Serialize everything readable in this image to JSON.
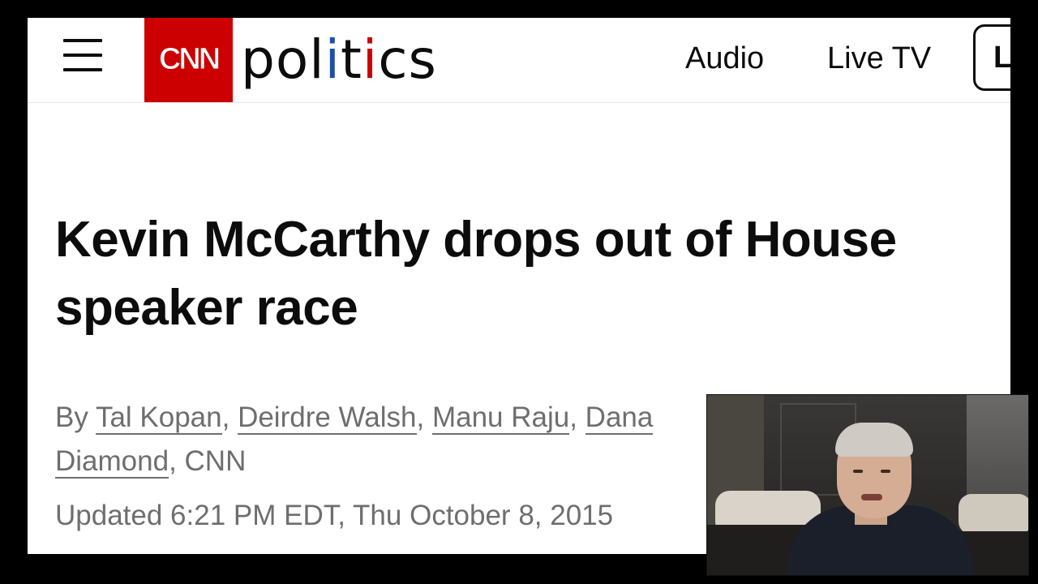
{
  "header": {
    "logo_text": "CNN",
    "section_prefix": "pol",
    "section_i1": "i",
    "section_mid": "t",
    "section_i2": "i",
    "section_suffix": "cs",
    "nav": {
      "audio": "Audio",
      "live_tv": "Live TV",
      "login_partial": "L"
    }
  },
  "article": {
    "headline": "Kevin McCarthy drops out of House speaker race",
    "byline_prefix": "By ",
    "authors": [
      "Tal Kopan",
      "Deirdre Walsh",
      "Manu Raju",
      "Dana",
      "Diamond"
    ],
    "byline_separator": ", ",
    "byline_suffix": ", CNN",
    "timestamp": "Updated 6:21 PM EDT, Thu October 8, 2015"
  },
  "colors": {
    "cnn_red": "#cc0000",
    "politics_blue": "#1e4fa8",
    "text_primary": "#0c0c0c",
    "text_secondary": "#6e6e6e"
  }
}
